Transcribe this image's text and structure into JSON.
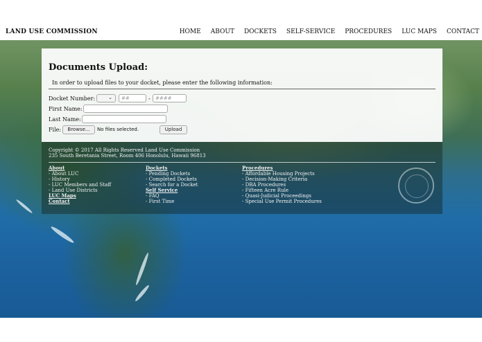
{
  "header": {
    "logo": "LAND USE COMMISSION",
    "nav": [
      "HOME",
      "ABOUT",
      "DOCKETS",
      "SELF-SERVICE",
      "PROCEDURES",
      "LUC MAPS",
      "CONTACT"
    ]
  },
  "form": {
    "title": "Documents Upload:",
    "intro": "In order to upload files to your docket, please enter the following information:",
    "docket_label": "Docket Number:",
    "docket_part1_placeholder": "##",
    "docket_separator": "-",
    "docket_part2_placeholder": "####",
    "first_name_label": "First Name:",
    "last_name_label": "Last Name:",
    "file_label": "File:",
    "browse_label": "Browse...",
    "no_file_text": "No files selected.",
    "upload_label": "Upload"
  },
  "footer": {
    "copyright": "Copyright © 2017 All Rights Reserved Land Use Commission",
    "address": "235 South Beretania Street, Room 406 Honolulu, Hawaii 96813",
    "col1": {
      "heading": "About",
      "items": [
        "- About LUC",
        "- History",
        "- LUC Members and Staff",
        "- Land Use Districts"
      ],
      "heading2": "LUC Maps",
      "heading3": "Contact"
    },
    "col2": {
      "heading": "Dockets",
      "items": [
        "- Pending Dockets",
        "- Completed Dockets",
        "- Search for a Docket"
      ],
      "heading2": "Self Service",
      "items2": [
        "- FAQ",
        "- First Time"
      ]
    },
    "col3": {
      "heading": "Procedures",
      "items": [
        "- Affordable Housing Projects",
        "- Decision-Making Criteria",
        "- DBA Procedures",
        "- Fifteen Acre Rule",
        "- Quasi-Judicial Proceedings",
        "- Special Use Permit Procedures"
      ]
    }
  }
}
